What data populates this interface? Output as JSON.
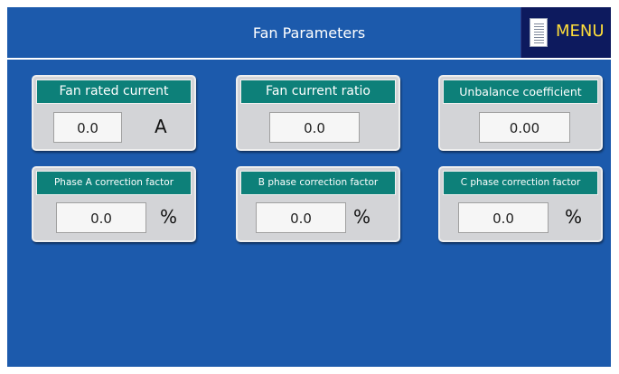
{
  "header": {
    "title": "Fan Parameters"
  },
  "menu_button": {
    "label": "MENU",
    "icon": "document-icon"
  },
  "panels": [
    {
      "title": "Fan rated current",
      "value": "0.0",
      "unit": "A"
    },
    {
      "title": "Fan current ratio",
      "value": "0.0",
      "unit": ""
    },
    {
      "title": "Unbalance coefficient",
      "value": "0.00",
      "unit": ""
    },
    {
      "title": "Phase A correction factor",
      "value": "0.0",
      "unit": "%"
    },
    {
      "title": "B phase correction factor",
      "value": "0.0",
      "unit": "%"
    },
    {
      "title": "C phase correction factor",
      "value": "0.0",
      "unit": "%"
    }
  ],
  "colors": {
    "background": "#1c5aac",
    "panel_title_bg": "#0d8079",
    "menu_bg": "#0d1a5e",
    "menu_text": "#ffde3a"
  }
}
